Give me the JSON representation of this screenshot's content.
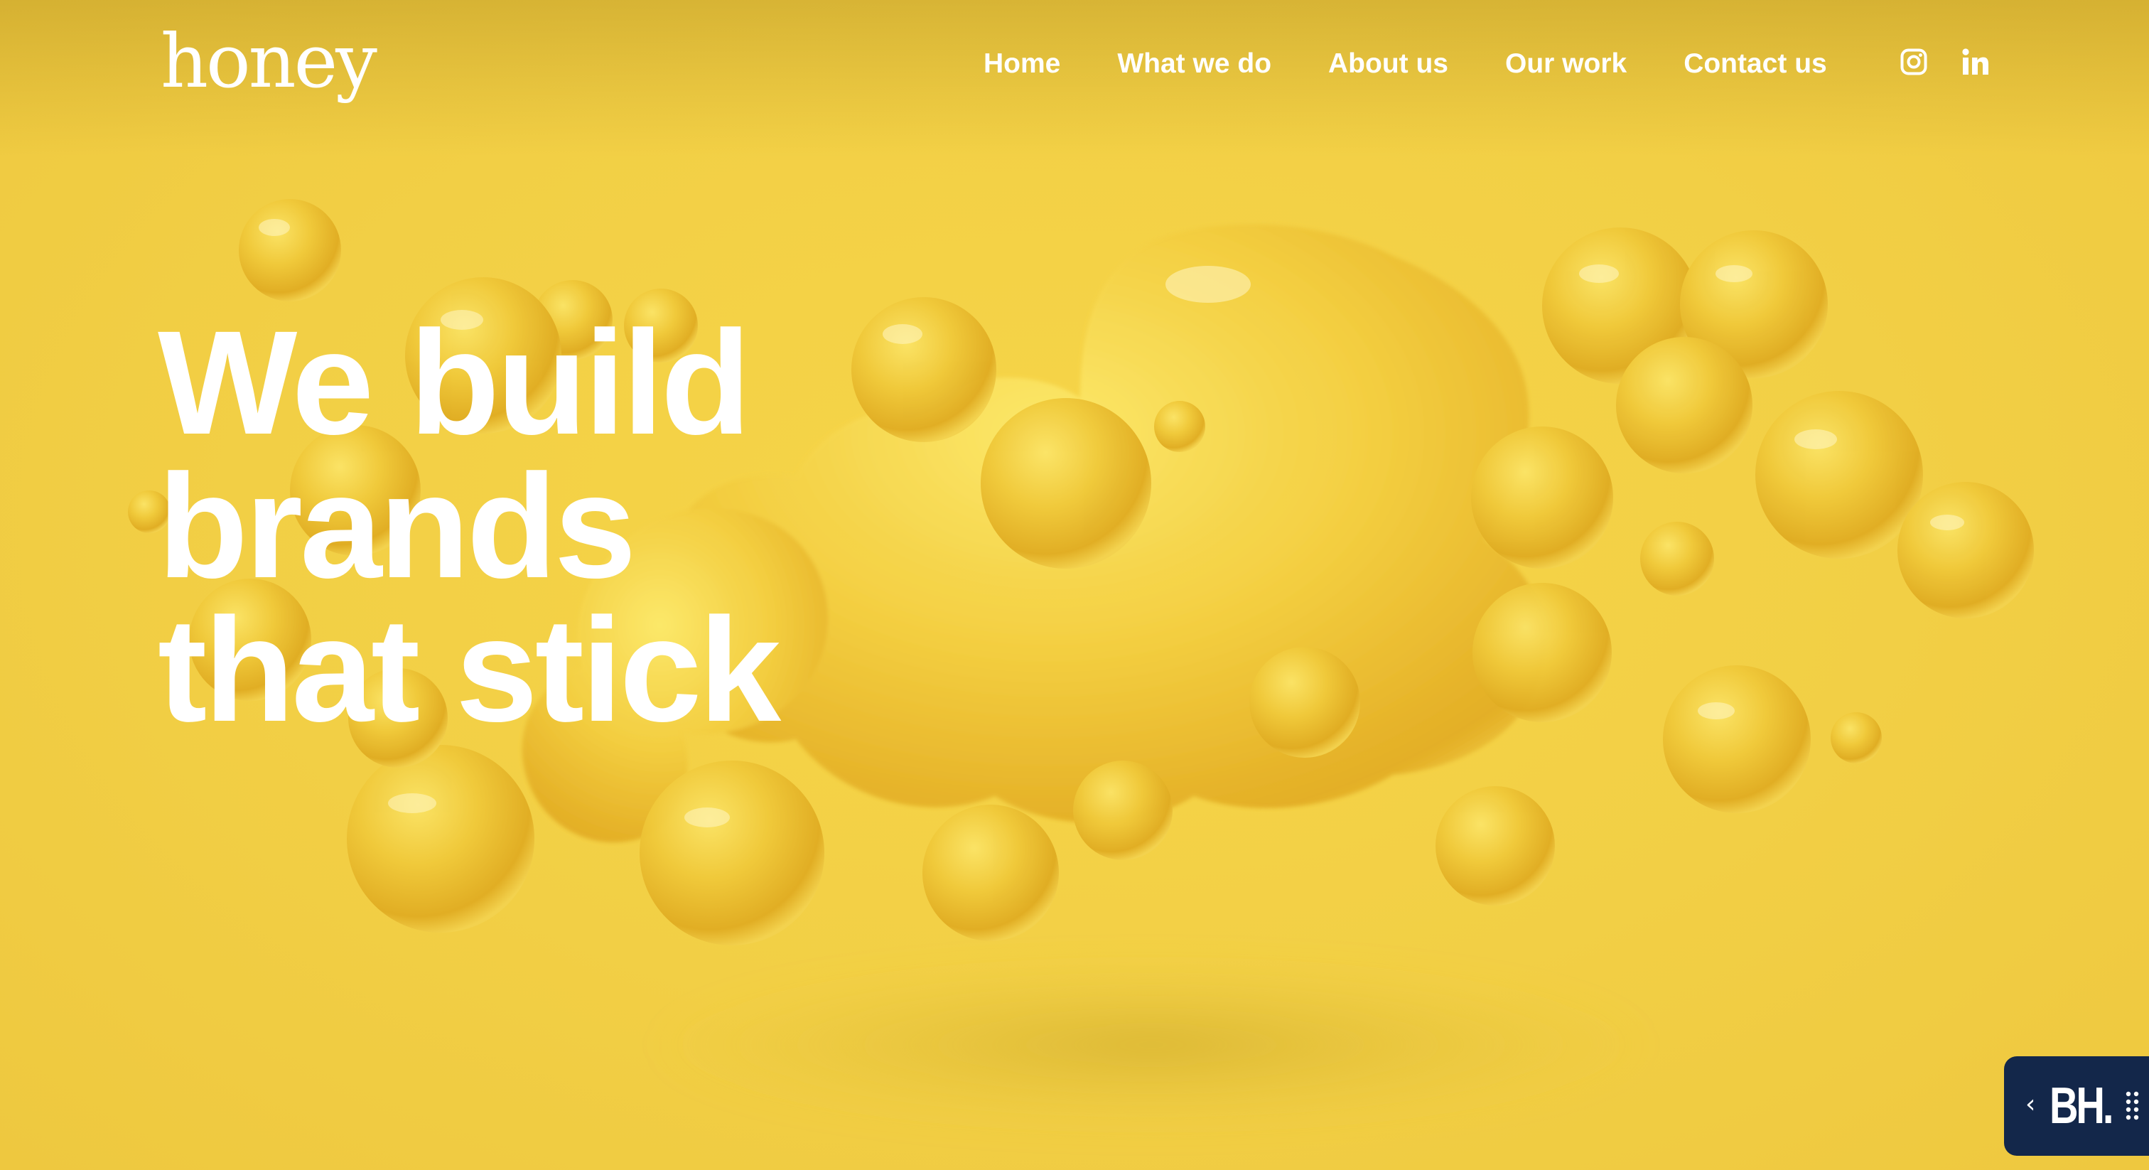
{
  "brand": {
    "logo_text": "honey"
  },
  "nav": {
    "items": [
      {
        "label": "Home"
      },
      {
        "label": "What we do"
      },
      {
        "label": "About us"
      },
      {
        "label": "Our work"
      },
      {
        "label": "Contact us"
      }
    ],
    "social": [
      {
        "icon": "instagram-icon"
      },
      {
        "icon": "linkedin-icon"
      }
    ]
  },
  "hero": {
    "headline_lines": [
      "We build",
      "brands",
      "that stick"
    ],
    "background_color": "#f2cf45",
    "text_color": "#ffffff"
  },
  "widget": {
    "logo_text": "BH.",
    "chevron": "‹",
    "background_color": "#13274a"
  }
}
